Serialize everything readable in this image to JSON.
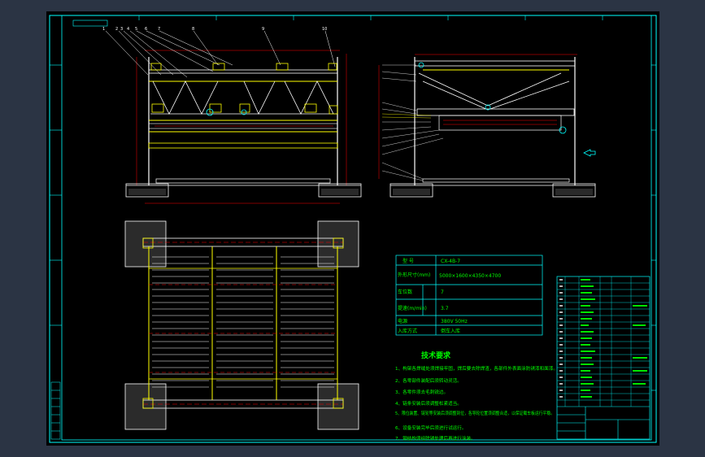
{
  "drawing": {
    "spec_table": {
      "rows": [
        {
          "label": "型    号",
          "value": "CX-4B-7"
        },
        {
          "label": "外形尺寸(mm)",
          "value": "5000×1600×4350×4700"
        },
        {
          "label": "车位数",
          "value": "7"
        },
        {
          "label": "提速(m/min)",
          "value": "3.7"
        },
        {
          "label": "电源",
          "value": "380V 50Hz"
        },
        {
          "label": "入库方式",
          "value": "倒车入库"
        }
      ]
    },
    "tech_requirements": {
      "title": "技术要求",
      "items": [
        "1、构架各焊缝处须焊接牢固，焊后要去除焊渣，各部件外表面涂防锈漆和面漆。",
        "2、各零部件装配后须转动灵活。",
        "3、各零件须去毛刺锐边。",
        "4、链条安装后须调整松紧适当。",
        "5、限位装置、链轮等安装后须调整到位，各导轮位置须调整合适，以保证载车板运行平稳。",
        "6、设备安装完毕后须进行试运行。",
        "7、钢结构须经除锈处理后再进行涂装。"
      ]
    },
    "title_block": {
      "cells": [
        "1",
        "2",
        "3",
        "4",
        "5",
        "6",
        "7",
        "8",
        "9",
        "10",
        "11",
        "12",
        "13",
        "14",
        "15",
        "16",
        "17",
        "18",
        "19",
        "20"
      ]
    }
  },
  "colors": {
    "background": "#000000",
    "frame": "#00ffff",
    "structure": "#ffffff",
    "highlight": "#ffff00",
    "dimension": "#ff0000",
    "text": "#00ff00",
    "window": "#2b3444"
  }
}
